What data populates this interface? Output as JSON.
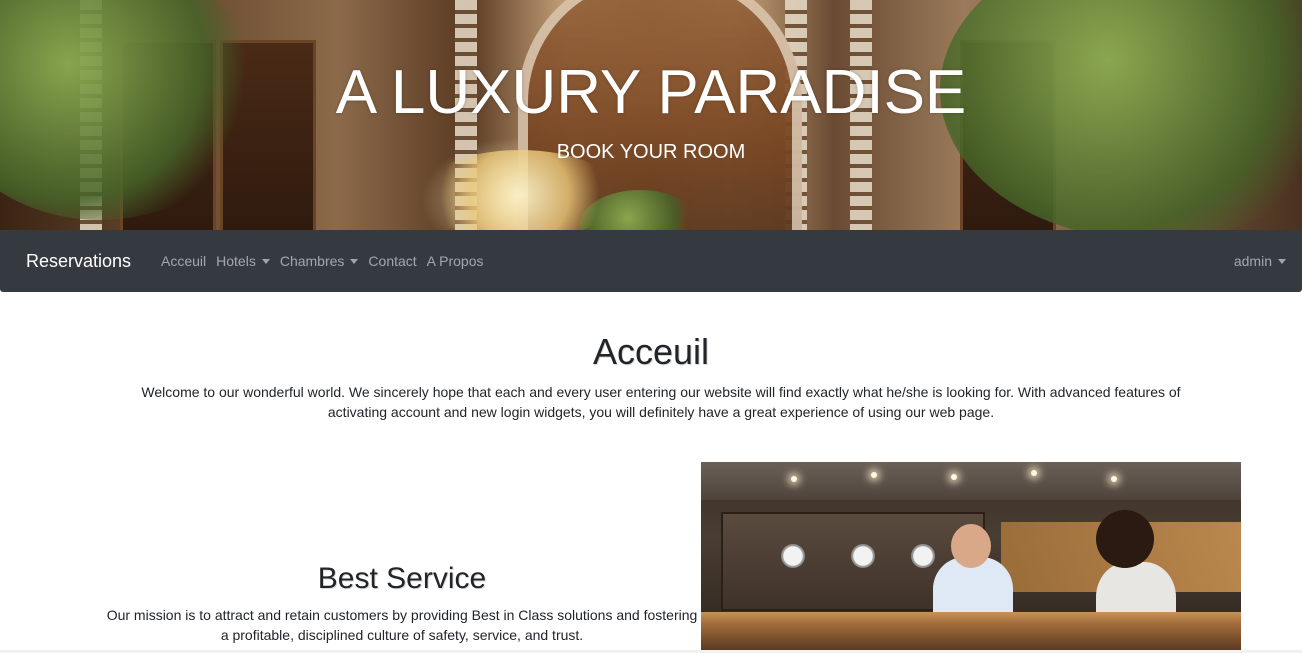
{
  "hero": {
    "title": "A LUXURY PARADISE",
    "subtitle": "BOOK YOUR ROOM"
  },
  "navbar": {
    "brand": "Reservations",
    "links": [
      {
        "label": "Acceuil",
        "dropdown": false
      },
      {
        "label": "Hotels",
        "dropdown": true
      },
      {
        "label": "Chambres",
        "dropdown": true
      },
      {
        "label": "Contact",
        "dropdown": false
      },
      {
        "label": "A Propos",
        "dropdown": false
      }
    ],
    "user": "admin",
    "user_dropdown": true
  },
  "main": {
    "title": "Acceuil",
    "intro": "Welcome to our wonderful world. We sincerely hope that each and every user entering our website will find exactly what he/she is looking for. With advanced features of activating account and new login widgets, you will definitely have a great experience of using our web page.",
    "service": {
      "title": "Best Service",
      "text": "Our mission is to attract and retain customers by providing Best in Class solutions and fostering a profitable, disciplined culture of safety, service, and trust."
    }
  },
  "colors": {
    "navbar_bg": "#343a40",
    "nav_link": "rgba(255,255,255,0.55)",
    "brand": "#ffffff",
    "text": "#212529"
  },
  "icons": {
    "dropdown": "caret-down-icon"
  }
}
